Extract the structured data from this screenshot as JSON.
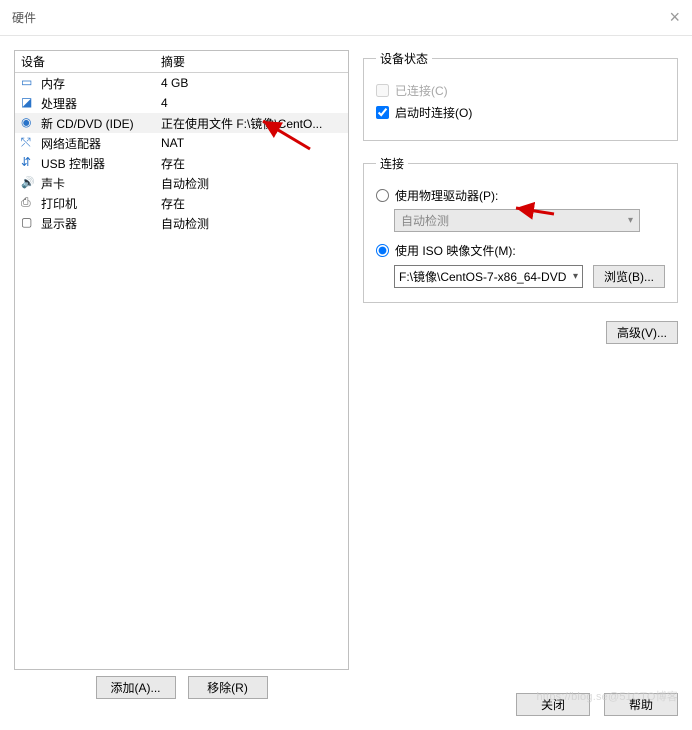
{
  "window": {
    "title": "硬件"
  },
  "table": {
    "col_device": "设备",
    "col_summary": "摘要",
    "rows": [
      {
        "icon": "ic-mem",
        "dev": "内存",
        "sum": "4 GB"
      },
      {
        "icon": "ic-cpu",
        "dev": "处理器",
        "sum": "4"
      },
      {
        "icon": "ic-cd",
        "dev": "新 CD/DVD (IDE)",
        "sum": "正在使用文件 F:\\镜像\\CentO..."
      },
      {
        "icon": "ic-net",
        "dev": "网络适配器",
        "sum": "NAT"
      },
      {
        "icon": "ic-usb",
        "dev": "USB 控制器",
        "sum": "存在"
      },
      {
        "icon": "ic-snd",
        "dev": "声卡",
        "sum": "自动检测"
      },
      {
        "icon": "ic-prn",
        "dev": "打印机",
        "sum": "存在"
      },
      {
        "icon": "ic-disp",
        "dev": "显示器",
        "sum": "自动检测"
      }
    ]
  },
  "status": {
    "group": "设备状态",
    "connected": "已连接(C)",
    "connect_on_power": "启动时连接(O)"
  },
  "connect": {
    "group": "连接",
    "physical": "使用物理驱动器(P):",
    "auto_detect": "自动检测",
    "iso": "使用 ISO 映像文件(M):",
    "iso_path": "F:\\镜像\\CentOS-7-x86_64-DVD",
    "browse": "浏览(B)...",
    "advanced": "高级(V)..."
  },
  "buttons": {
    "add": "添加(A)...",
    "remove": "移除(R)",
    "close": "关闭",
    "help": "帮助"
  },
  "watermark": "https://blog.se@51CTO博客"
}
